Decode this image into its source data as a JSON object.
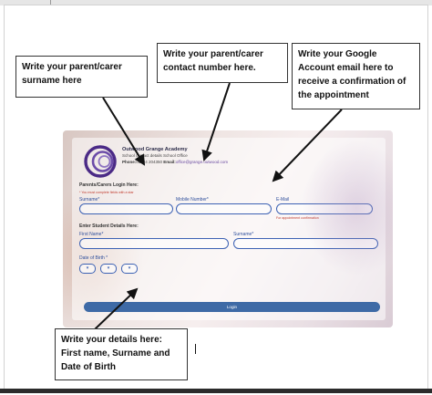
{
  "callouts": {
    "surname": "Write your parent/carer surname here",
    "phone": "Write your parent/carer contact number here.",
    "email": "Write your Google Account email here to receive a confirmation of the appointment",
    "details": "Write your details here: First name, Surname and Date of Birth"
  },
  "school": {
    "name": "Outwood Grange Academy",
    "contact": "School contact details  School Office",
    "phone_label": "Phone:",
    "phone": "01924 204350",
    "email_label": "Email:",
    "email": "office@grange.outwood.com"
  },
  "parents": {
    "title": "Parents/Carers Login Here:",
    "note": "* You must complete fields with a star",
    "surname_label": "Surname*",
    "mobile_label": "Mobile Number*",
    "email_label": "E-Mail",
    "email_note": "For appointment confirmation"
  },
  "student": {
    "title": "Enter Student Details Here:",
    "first_name_label": "First Name*",
    "surname_label": "Surname*",
    "dob_label": "Date of Birth *",
    "dob_selects": [
      "▾",
      "▾",
      "▾"
    ]
  },
  "login_label": "Login",
  "colors": {
    "accent": "#3e6aa6",
    "field_border": "#3d62b4",
    "required_note": "#c0392b",
    "logo_purple": "#4b2a86"
  },
  "icons": {
    "logo": "school-logo-icon",
    "dropdown": "chevron-down-icon"
  }
}
